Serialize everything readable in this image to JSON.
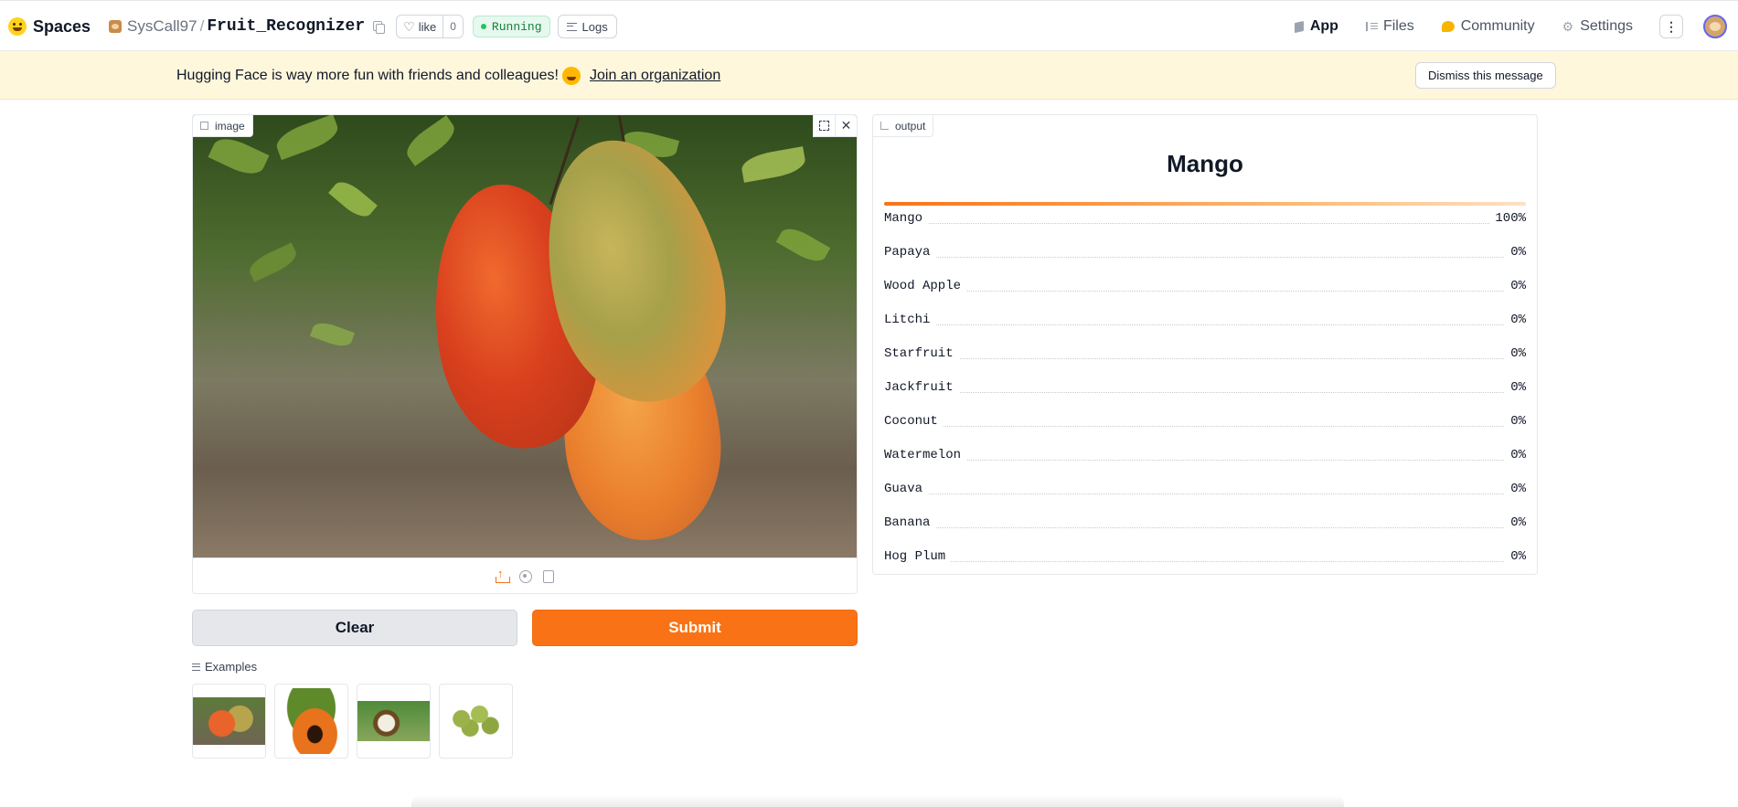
{
  "header": {
    "brand": "Spaces",
    "owner": "SysCall97",
    "separator": "/",
    "repo": "Fruit_Recognizer",
    "like_label": "like",
    "like_count": "0",
    "status": "Running",
    "logs_label": "Logs",
    "tabs": [
      {
        "label": "App",
        "icon": "app-icon",
        "active": true
      },
      {
        "label": "Files",
        "icon": "files-icon",
        "active": false
      },
      {
        "label": "Community",
        "icon": "community-icon",
        "active": false
      },
      {
        "label": "Settings",
        "icon": "gear-icon",
        "active": false
      }
    ]
  },
  "banner": {
    "text": "Hugging Face is way more fun with friends and colleagues!",
    "link": "Join an organization",
    "dismiss": "Dismiss this message"
  },
  "input": {
    "label": "image",
    "close_glyph": "✕"
  },
  "buttons": {
    "clear": "Clear",
    "submit": "Submit"
  },
  "examples": {
    "label": "Examples"
  },
  "output": {
    "label": "output",
    "prediction": "Mango",
    "confidences": [
      {
        "label": "Mango",
        "value": "100%",
        "fraction": 1.0
      },
      {
        "label": "Papaya",
        "value": "0%",
        "fraction": 0
      },
      {
        "label": "Wood Apple",
        "value": "0%",
        "fraction": 0
      },
      {
        "label": "Litchi",
        "value": "0%",
        "fraction": 0
      },
      {
        "label": "Starfruit",
        "value": "0%",
        "fraction": 0
      },
      {
        "label": "Jackfruit",
        "value": "0%",
        "fraction": 0
      },
      {
        "label": "Coconut",
        "value": "0%",
        "fraction": 0
      },
      {
        "label": "Watermelon",
        "value": "0%",
        "fraction": 0
      },
      {
        "label": "Guava",
        "value": "0%",
        "fraction": 0
      },
      {
        "label": "Banana",
        "value": "0%",
        "fraction": 0
      },
      {
        "label": "Hog Plum",
        "value": "0%",
        "fraction": 0
      }
    ]
  },
  "colors": {
    "accent": "#f97316",
    "running": "#15803d",
    "banner_bg": "#fef7dc"
  }
}
